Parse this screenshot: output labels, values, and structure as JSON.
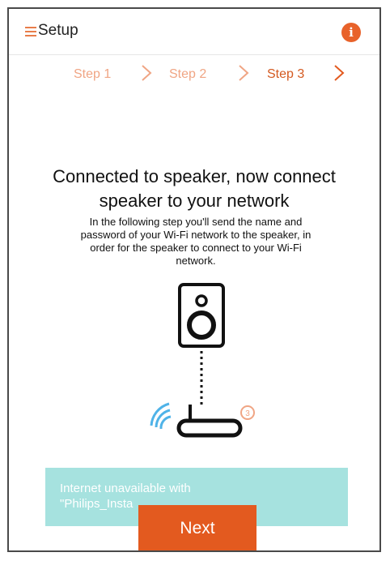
{
  "header": {
    "title": "Setup",
    "info_label": "i"
  },
  "steps": [
    {
      "label": "Step 1",
      "active": false
    },
    {
      "label": "Step 2",
      "active": false
    },
    {
      "label": "Step 3",
      "active": true
    }
  ],
  "main": {
    "headline_line1": "Connected to speaker, now connect",
    "headline_line2": "speaker to your network",
    "description_line1": "In the following step you'll send the name and",
    "description_line2": "password of your Wi-Fi network to the speaker, in",
    "description_line3": "order for the speaker to connect to your Wi-Fi",
    "description_line4": "network.",
    "router_badge": "3"
  },
  "toast": {
    "line1": "Internet unavailable with",
    "line2": "\"Philips_Insta"
  },
  "footer": {
    "next_label": "Next"
  },
  "colors": {
    "accent": "#e35a1f",
    "step_inactive": "#f0a584",
    "step_active": "#d45a21",
    "wifi": "#4fb3e8",
    "toast_bg": "#a6e2df"
  },
  "icons": [
    "menu-icon",
    "info-icon",
    "chevron-right-icon",
    "speaker-icon",
    "router-icon",
    "wifi-signal-icon"
  ]
}
